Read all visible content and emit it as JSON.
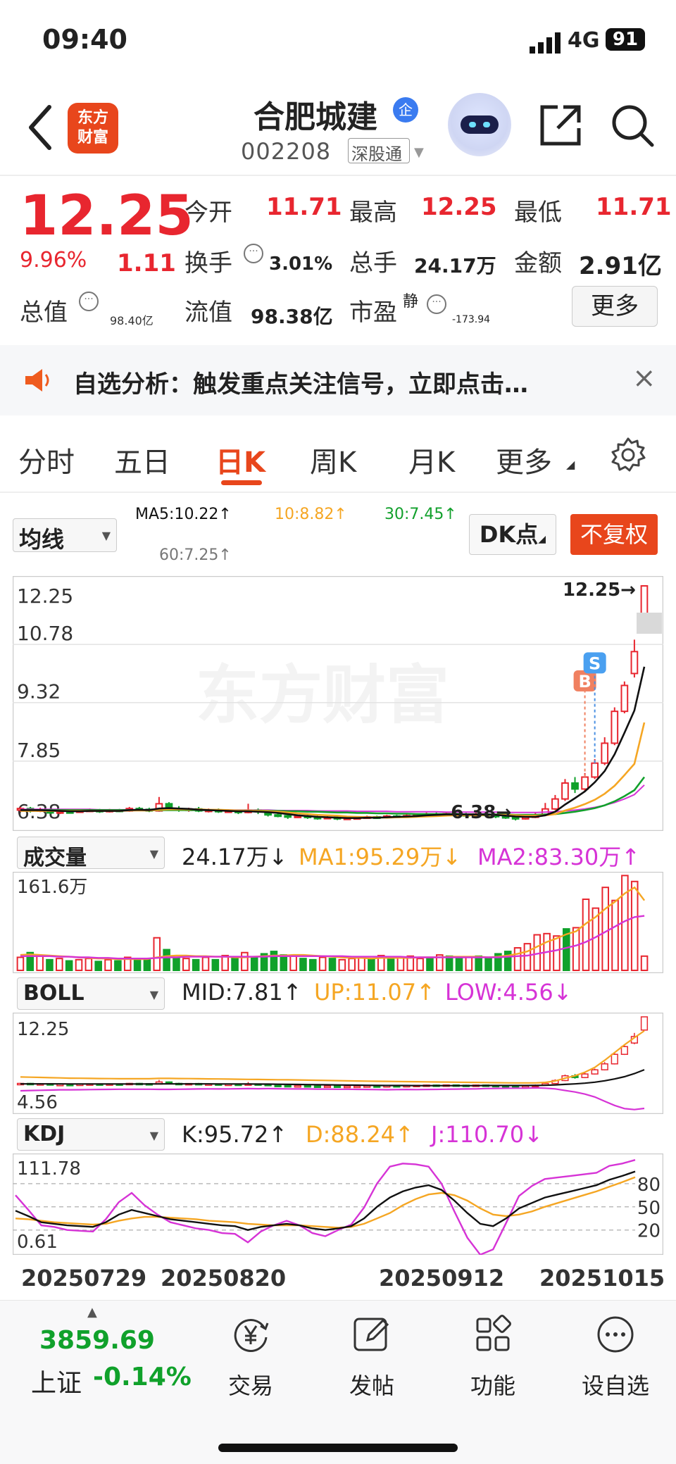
{
  "status": {
    "time": "09:40",
    "network": "4G",
    "battery": "91"
  },
  "header": {
    "logo": "东方\n财富",
    "title": "合肥城建",
    "badge": "企",
    "code": "002208",
    "tag": "深股通"
  },
  "quote": {
    "price": "12.25",
    "pct": "9.96%",
    "chg": "1.11",
    "open_lbl": "今开",
    "open": "11.71",
    "high_lbl": "最高",
    "high": "12.25",
    "low_lbl": "最低",
    "low": "11.71",
    "turn_lbl": "换手",
    "turn": "3.01%",
    "vol_lbl": "总手",
    "vol": "24.17万",
    "amt_lbl": "金额",
    "amt": "2.91亿",
    "cap_lbl": "总值",
    "cap": "98.40亿",
    "flt_lbl": "流值",
    "flt": "98.38亿",
    "pe_lbl": "市盈",
    "pe_sup": "静",
    "pe": "-173.94",
    "more": "更多"
  },
  "notice": {
    "text": "自选分析：触发重点关注信号，立即点击…"
  },
  "tabs": [
    "分时",
    "五日",
    "日K",
    "周K",
    "月K",
    "更多"
  ],
  "chart_ctrl": {
    "ma_select": "均线",
    "ma5": "MA5:10.22↑",
    "ma10": "10:8.82↑",
    "ma30": "30:7.45↑",
    "ma60": "60:7.25↑",
    "dk": "DK点",
    "fuquan": "不复权",
    "mark_b": "B",
    "mark_s": "S",
    "watermark": "东方财富"
  },
  "colors": {
    "up": "#e8262f",
    "down": "#10a12b",
    "accent": "#e8461c",
    "ma5": "#111111",
    "ma10": "#f5a623",
    "ma30": "#12a02c",
    "ma60": "#d633d6"
  },
  "chart_data": [
    {
      "type": "candlestick",
      "ylabels": [
        "12.25",
        "10.78",
        "9.32",
        "7.85",
        "6.38"
      ],
      "ylim": [
        6.38,
        12.25
      ],
      "max_label": "12.25→",
      "min_label": "6.38→",
      "candles": [
        [
          6.62,
          6.66,
          6.58,
          6.7
        ],
        [
          6.66,
          6.6,
          6.56,
          6.7
        ],
        [
          6.6,
          6.63,
          6.57,
          6.68
        ],
        [
          6.63,
          6.55,
          6.52,
          6.66
        ],
        [
          6.55,
          6.58,
          6.52,
          6.62
        ],
        [
          6.58,
          6.57,
          6.54,
          6.62
        ],
        [
          6.57,
          6.6,
          6.55,
          6.63
        ],
        [
          6.6,
          6.62,
          6.57,
          6.66
        ],
        [
          6.62,
          6.58,
          6.55,
          6.65
        ],
        [
          6.58,
          6.62,
          6.56,
          6.65
        ],
        [
          6.62,
          6.6,
          6.57,
          6.65
        ],
        [
          6.6,
          6.66,
          6.58,
          6.7
        ],
        [
          6.66,
          6.64,
          6.6,
          6.7
        ],
        [
          6.64,
          6.6,
          6.57,
          6.68
        ],
        [
          6.6,
          6.78,
          6.58,
          6.95
        ],
        [
          6.78,
          6.66,
          6.62,
          6.82
        ],
        [
          6.66,
          6.62,
          6.58,
          6.72
        ],
        [
          6.62,
          6.65,
          6.58,
          6.68
        ],
        [
          6.65,
          6.6,
          6.57,
          6.7
        ],
        [
          6.6,
          6.62,
          6.56,
          6.66
        ],
        [
          6.62,
          6.58,
          6.55,
          6.66
        ],
        [
          6.58,
          6.6,
          6.55,
          6.64
        ],
        [
          6.6,
          6.56,
          6.52,
          6.63
        ],
        [
          6.56,
          6.62,
          6.54,
          6.78
        ],
        [
          6.62,
          6.58,
          6.52,
          6.66
        ],
        [
          6.58,
          6.5,
          6.46,
          6.62
        ],
        [
          6.5,
          6.48,
          6.44,
          6.55
        ],
        [
          6.48,
          6.45,
          6.4,
          6.52
        ],
        [
          6.45,
          6.47,
          6.42,
          6.5
        ],
        [
          6.47,
          6.44,
          6.4,
          6.5
        ],
        [
          6.44,
          6.42,
          6.38,
          6.48
        ],
        [
          6.42,
          6.44,
          6.4,
          6.48
        ],
        [
          6.44,
          6.4,
          6.37,
          6.46
        ],
        [
          6.4,
          6.42,
          6.38,
          6.45
        ],
        [
          6.42,
          6.43,
          6.39,
          6.46
        ],
        [
          6.43,
          6.45,
          6.41,
          6.48
        ],
        [
          6.45,
          6.44,
          6.41,
          6.48
        ],
        [
          6.44,
          6.47,
          6.42,
          6.5
        ],
        [
          6.47,
          6.46,
          6.43,
          6.5
        ],
        [
          6.46,
          6.48,
          6.44,
          6.52
        ],
        [
          6.48,
          6.5,
          6.45,
          6.54
        ],
        [
          6.5,
          6.52,
          6.47,
          6.56
        ],
        [
          6.52,
          6.5,
          6.47,
          6.56
        ],
        [
          6.5,
          6.53,
          6.48,
          6.57
        ],
        [
          6.53,
          6.51,
          6.48,
          6.57
        ],
        [
          6.51,
          6.5,
          6.46,
          6.55
        ],
        [
          6.5,
          6.52,
          6.47,
          6.56
        ],
        [
          6.52,
          6.49,
          6.45,
          6.55
        ],
        [
          6.49,
          6.46,
          6.42,
          6.52
        ],
        [
          6.46,
          6.44,
          6.4,
          6.5
        ],
        [
          6.44,
          6.4,
          6.36,
          6.48
        ],
        [
          6.4,
          6.44,
          6.38,
          6.52
        ],
        [
          6.44,
          6.5,
          6.42,
          6.56
        ],
        [
          6.5,
          6.65,
          6.48,
          6.8
        ],
        [
          6.65,
          6.9,
          6.62,
          7.0
        ],
        [
          6.9,
          7.3,
          6.85,
          7.4
        ],
        [
          7.3,
          7.15,
          7.05,
          7.45
        ],
        [
          7.15,
          7.45,
          7.1,
          7.55
        ],
        [
          7.45,
          7.8,
          7.4,
          7.9
        ],
        [
          7.8,
          8.3,
          7.75,
          8.45
        ],
        [
          8.3,
          9.1,
          8.25,
          9.2
        ],
        [
          9.1,
          9.75,
          9.05,
          9.85
        ],
        [
          10.05,
          10.6,
          9.95,
          10.9
        ],
        [
          11.14,
          12.25,
          11.71,
          12.25
        ]
      ],
      "ma5": [
        6.62,
        6.62,
        6.62,
        6.61,
        6.6,
        6.59,
        6.59,
        6.6,
        6.6,
        6.6,
        6.6,
        6.62,
        6.63,
        6.62,
        6.66,
        6.67,
        6.66,
        6.65,
        6.63,
        6.62,
        6.61,
        6.6,
        6.59,
        6.59,
        6.58,
        6.57,
        6.55,
        6.52,
        6.49,
        6.47,
        6.45,
        6.44,
        6.43,
        6.42,
        6.42,
        6.43,
        6.43,
        6.44,
        6.45,
        6.46,
        6.47,
        6.49,
        6.5,
        6.51,
        6.51,
        6.51,
        6.51,
        6.51,
        6.5,
        6.48,
        6.46,
        6.45,
        6.45,
        6.49,
        6.58,
        6.76,
        6.92,
        7.09,
        7.32,
        7.6,
        8.02,
        8.56,
        9.12,
        10.22
      ],
      "ma10": [
        6.6,
        6.6,
        6.6,
        6.6,
        6.6,
        6.6,
        6.6,
        6.6,
        6.6,
        6.6,
        6.6,
        6.61,
        6.61,
        6.61,
        6.63,
        6.64,
        6.64,
        6.64,
        6.64,
        6.63,
        6.63,
        6.62,
        6.61,
        6.61,
        6.6,
        6.59,
        6.58,
        6.56,
        6.54,
        6.52,
        6.5,
        6.49,
        6.48,
        6.46,
        6.45,
        6.44,
        6.44,
        6.43,
        6.44,
        6.44,
        6.45,
        6.46,
        6.47,
        6.48,
        6.49,
        6.49,
        6.49,
        6.5,
        6.5,
        6.5,
        6.49,
        6.48,
        6.48,
        6.49,
        6.52,
        6.61,
        6.68,
        6.77,
        6.88,
        7.03,
        7.23,
        7.5,
        7.78,
        8.82
      ],
      "ma30": [
        6.62,
        6.62,
        6.62,
        6.62,
        6.62,
        6.62,
        6.62,
        6.62,
        6.62,
        6.62,
        6.62,
        6.62,
        6.62,
        6.62,
        6.62,
        6.62,
        6.62,
        6.62,
        6.62,
        6.62,
        6.62,
        6.61,
        6.61,
        6.61,
        6.61,
        6.6,
        6.6,
        6.59,
        6.59,
        6.58,
        6.58,
        6.57,
        6.56,
        6.56,
        6.55,
        6.55,
        6.54,
        6.54,
        6.53,
        6.53,
        6.52,
        6.52,
        6.52,
        6.52,
        6.52,
        6.51,
        6.51,
        6.51,
        6.51,
        6.51,
        6.5,
        6.5,
        6.5,
        6.51,
        6.52,
        6.55,
        6.58,
        6.62,
        6.67,
        6.74,
        6.84,
        6.97,
        7.12,
        7.45
      ],
      "ma60": [
        6.64,
        6.64,
        6.64,
        6.64,
        6.64,
        6.64,
        6.64,
        6.64,
        6.63,
        6.63,
        6.63,
        6.63,
        6.63,
        6.63,
        6.63,
        6.63,
        6.63,
        6.63,
        6.63,
        6.63,
        6.62,
        6.62,
        6.62,
        6.62,
        6.62,
        6.62,
        6.61,
        6.61,
        6.61,
        6.61,
        6.6,
        6.6,
        6.6,
        6.6,
        6.59,
        6.59,
        6.59,
        6.59,
        6.58,
        6.58,
        6.58,
        6.58,
        6.58,
        6.57,
        6.57,
        6.57,
        6.57,
        6.57,
        6.57,
        6.56,
        6.56,
        6.56,
        6.56,
        6.57,
        6.58,
        6.6,
        6.62,
        6.65,
        6.69,
        6.74,
        6.81,
        6.9,
        7.01,
        7.25
      ]
    },
    {
      "type": "bar",
      "title": "成交量",
      "value_lbl": "24.17万↓",
      "ma1_lbl": "MA1:95.29万↓",
      "ma2_lbl": "MA2:83.30万↑",
      "ymax_label": "161.6万",
      "ylim": [
        0,
        161.6
      ],
      "values": [
        22,
        30,
        25,
        18,
        20,
        16,
        18,
        20,
        15,
        18,
        16,
        22,
        20,
        18,
        55,
        35,
        22,
        20,
        18,
        22,
        18,
        25,
        20,
        30,
        22,
        28,
        32,
        26,
        24,
        20,
        18,
        22,
        20,
        18,
        20,
        22,
        18,
        25,
        20,
        22,
        24,
        20,
        22,
        26,
        24,
        20,
        22,
        24,
        20,
        28,
        32,
        38,
        45,
        60,
        62,
        58,
        70,
        72,
        120,
        105,
        140,
        118,
        160,
        150,
        24
      ],
      "ma1": [
        26,
        27,
        26,
        25,
        24,
        23,
        22,
        21,
        20,
        20,
        19,
        19,
        19,
        19,
        22,
        24,
        25,
        25,
        24,
        24,
        23,
        23,
        22,
        22,
        23,
        24,
        25,
        25,
        26,
        26,
        25,
        24,
        23,
        22,
        21,
        21,
        20,
        21,
        21,
        21,
        21,
        22,
        22,
        22,
        23,
        23,
        23,
        23,
        22,
        23,
        25,
        28,
        32,
        40,
        48,
        54,
        61,
        66,
        79,
        90,
        104,
        116,
        130,
        140,
        118
      ],
      "ma2": [
        24,
        24,
        24,
        24,
        23,
        23,
        22,
        22,
        21,
        21,
        20,
        20,
        20,
        20,
        21,
        22,
        22,
        23,
        23,
        23,
        23,
        23,
        23,
        23,
        23,
        23,
        24,
        24,
        24,
        24,
        24,
        24,
        24,
        24,
        23,
        23,
        23,
        23,
        23,
        23,
        22,
        22,
        22,
        22,
        22,
        22,
        22,
        22,
        22,
        22,
        23,
        24,
        25,
        28,
        31,
        34,
        38,
        42,
        48,
        56,
        65,
        74,
        83,
        90,
        92
      ]
    },
    {
      "type": "line",
      "title": "BOLL",
      "mid_lbl": "MID:7.81↑",
      "up_lbl": "UP:11.07↑",
      "low_lbl": "LOW:4.56↓",
      "ylabels": [
        "12.25",
        "4.56"
      ],
      "ylim": [
        4.56,
        12.25
      ],
      "mid": [
        6.62,
        6.62,
        6.62,
        6.62,
        6.62,
        6.61,
        6.61,
        6.61,
        6.61,
        6.61,
        6.61,
        6.61,
        6.61,
        6.61,
        6.62,
        6.62,
        6.62,
        6.62,
        6.62,
        6.62,
        6.61,
        6.61,
        6.61,
        6.61,
        6.6,
        6.6,
        6.59,
        6.58,
        6.57,
        6.56,
        6.55,
        6.54,
        6.53,
        6.52,
        6.51,
        6.5,
        6.49,
        6.48,
        6.48,
        6.48,
        6.47,
        6.47,
        6.47,
        6.47,
        6.47,
        6.47,
        6.47,
        6.48,
        6.48,
        6.48,
        6.48,
        6.48,
        6.49,
        6.5,
        6.53,
        6.58,
        6.62,
        6.68,
        6.76,
        6.88,
        7.03,
        7.22,
        7.48,
        7.81
      ],
      "up": [
        7.2,
        7.18,
        7.16,
        7.14,
        7.12,
        7.1,
        7.09,
        7.08,
        7.07,
        7.06,
        7.05,
        7.05,
        7.05,
        7.05,
        7.08,
        7.08,
        7.07,
        7.06,
        7.05,
        7.04,
        7.03,
        7.02,
        7.01,
        7.0,
        6.99,
        6.98,
        6.97,
        6.96,
        6.95,
        6.93,
        6.92,
        6.9,
        6.89,
        6.87,
        6.86,
        6.85,
        6.84,
        6.83,
        6.82,
        6.81,
        6.8,
        6.79,
        6.78,
        6.77,
        6.76,
        6.75,
        6.74,
        6.73,
        6.72,
        6.71,
        6.7,
        6.7,
        6.7,
        6.74,
        6.86,
        7.1,
        7.3,
        7.6,
        8.0,
        8.6,
        9.25,
        9.9,
        10.5,
        11.07
      ],
      "low": [
        6.04,
        6.06,
        6.08,
        6.1,
        6.12,
        6.12,
        6.13,
        6.14,
        6.15,
        6.16,
        6.17,
        6.17,
        6.17,
        6.17,
        6.16,
        6.16,
        6.17,
        6.18,
        6.19,
        6.2,
        6.19,
        6.2,
        6.21,
        6.22,
        6.21,
        6.22,
        6.21,
        6.2,
        6.19,
        6.19,
        6.18,
        6.18,
        6.17,
        6.17,
        6.16,
        6.15,
        6.14,
        6.13,
        6.14,
        6.15,
        6.14,
        6.15,
        6.16,
        6.17,
        6.18,
        6.19,
        6.2,
        6.23,
        6.24,
        6.25,
        6.26,
        6.26,
        6.28,
        6.26,
        6.2,
        6.06,
        5.94,
        5.76,
        5.52,
        5.16,
        4.81,
        4.54,
        4.46,
        4.56
      ]
    },
    {
      "type": "line",
      "title": "KDJ",
      "k_lbl": "K:95.72↑",
      "d_lbl": "D:88.24↑",
      "j_lbl": "J:110.70↓",
      "ylabels": [
        "111.78",
        "0.61"
      ],
      "right_levels": [
        "80",
        "50",
        "20"
      ],
      "ylim": [
        0.61,
        111.78
      ],
      "k": [
        45,
        38,
        30,
        28,
        26,
        25,
        24,
        30,
        40,
        46,
        42,
        38,
        34,
        32,
        30,
        28,
        26,
        25,
        20,
        24,
        26,
        28,
        26,
        22,
        20,
        22,
        25,
        35,
        50,
        62,
        70,
        75,
        78,
        72,
        58,
        42,
        28,
        25,
        35,
        48,
        55,
        62,
        66,
        70,
        74,
        78,
        85,
        90,
        95.72
      ],
      "d": [
        35,
        34,
        32,
        30,
        29,
        28,
        27,
        28,
        32,
        35,
        37,
        37,
        36,
        35,
        34,
        32,
        31,
        30,
        28,
        27,
        26,
        26,
        26,
        25,
        24,
        23,
        24,
        28,
        35,
        42,
        52,
        60,
        66,
        68,
        65,
        58,
        48,
        40,
        38,
        40,
        44,
        50,
        55,
        60,
        65,
        70,
        76,
        82,
        88.24
      ],
      "j": [
        65,
        46,
        26,
        24,
        20,
        19,
        18,
        34,
        56,
        68,
        52,
        40,
        30,
        26,
        22,
        20,
        16,
        15,
        4,
        18,
        26,
        32,
        26,
        16,
        12,
        20,
        27,
        49,
        80,
        102,
        106,
        105,
        102,
        80,
        44,
        10,
        -12,
        -5,
        29,
        64,
        77,
        86,
        88,
        90,
        92,
        94,
        103,
        106,
        110.7
      ]
    }
  ],
  "xdates": [
    "20250729",
    "20250820",
    "20250912",
    "20251015"
  ],
  "bottom": {
    "index_val": "3859.69",
    "index_name": "上证",
    "index_pct": "-0.14%",
    "nav": [
      "交易",
      "发帖",
      "功能",
      "设自选"
    ]
  }
}
